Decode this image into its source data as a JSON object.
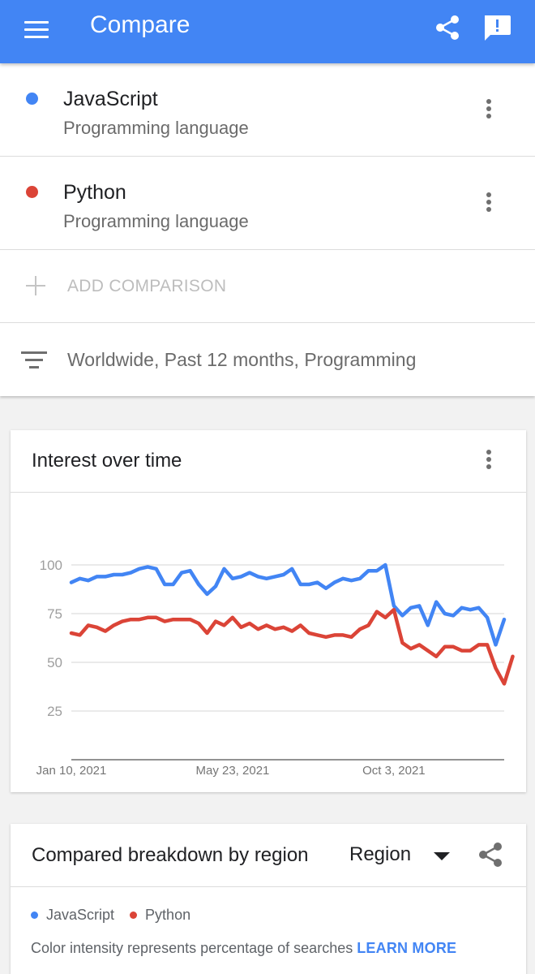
{
  "app_bar": {
    "title": "Compare",
    "menu_icon": "menu-icon",
    "share_icon": "share-icon",
    "feedback_icon": "feedback-icon",
    "color": "#4285f4"
  },
  "terms": [
    {
      "name": "JavaScript",
      "category": "Programming language",
      "color": "#4285f4"
    },
    {
      "name": "Python",
      "category": "Programming language",
      "color": "#db4437"
    }
  ],
  "add_comparison": {
    "label": "ADD COMPARISON"
  },
  "filters": {
    "label": "Worldwide, Past 12 months, Programming"
  },
  "interest_card": {
    "title": "Interest over time",
    "chart_data": {
      "type": "line",
      "title": "Interest over time",
      "x": [
        "2021-01-10",
        "2021-01-17",
        "2021-01-24",
        "2021-01-31",
        "2021-02-07",
        "2021-02-14",
        "2021-02-21",
        "2021-02-28",
        "2021-03-07",
        "2021-03-14",
        "2021-03-21",
        "2021-03-28",
        "2021-04-04",
        "2021-04-11",
        "2021-04-18",
        "2021-04-25",
        "2021-05-02",
        "2021-05-09",
        "2021-05-16",
        "2021-05-23",
        "2021-05-30",
        "2021-06-06",
        "2021-06-13",
        "2021-06-20",
        "2021-06-27",
        "2021-07-04",
        "2021-07-11",
        "2021-07-18",
        "2021-07-25",
        "2021-08-01",
        "2021-08-08",
        "2021-08-15",
        "2021-08-22",
        "2021-08-29",
        "2021-09-05",
        "2021-09-12",
        "2021-09-19",
        "2021-09-26",
        "2021-10-03",
        "2021-10-10",
        "2021-10-17",
        "2021-10-24",
        "2021-10-31",
        "2021-11-07",
        "2021-11-14",
        "2021-11-21",
        "2021-11-28",
        "2021-12-05",
        "2021-12-12",
        "2021-12-19",
        "2021-12-26",
        "2022-01-02"
      ],
      "x_tick_labels": [
        "Jan 10, 2021",
        "May 23, 2021",
        "Oct 3, 2021"
      ],
      "x_tick_indices": [
        0,
        19,
        38
      ],
      "y_ticks": [
        100,
        75,
        50,
        25
      ],
      "ylim": [
        0,
        100
      ],
      "grid": true,
      "series": [
        {
          "name": "JavaScript",
          "color": "#4285f4",
          "values": [
            91,
            93,
            92,
            94,
            94,
            95,
            95,
            96,
            98,
            99,
            98,
            90,
            90,
            96,
            97,
            90,
            85,
            89,
            98,
            93,
            94,
            96,
            94,
            93,
            94,
            95,
            98,
            90,
            90,
            91,
            88,
            91,
            93,
            92,
            93,
            97,
            97,
            100,
            79,
            74,
            78,
            79,
            69,
            81,
            75,
            74,
            78,
            77,
            78,
            73,
            59,
            72
          ]
        },
        {
          "name": "Python",
          "color": "#db4437",
          "values": [
            65,
            64,
            69,
            68,
            66,
            69,
            71,
            72,
            72,
            73,
            73,
            71,
            72,
            72,
            72,
            70,
            65,
            71,
            69,
            73,
            68,
            70,
            67,
            69,
            67,
            68,
            66,
            69,
            65,
            64,
            63,
            64,
            64,
            63,
            67,
            69,
            76,
            73,
            77,
            60,
            57,
            59,
            56,
            53,
            58,
            58,
            56,
            56,
            59,
            59,
            47,
            39,
            53
          ]
        }
      ]
    }
  },
  "region_card": {
    "title": "Compared breakdown by region",
    "select_value": "Region",
    "legend": [
      "JavaScript",
      "Python"
    ],
    "note": "Color intensity represents percentage of searches",
    "learn_more": "LEARN MORE"
  }
}
